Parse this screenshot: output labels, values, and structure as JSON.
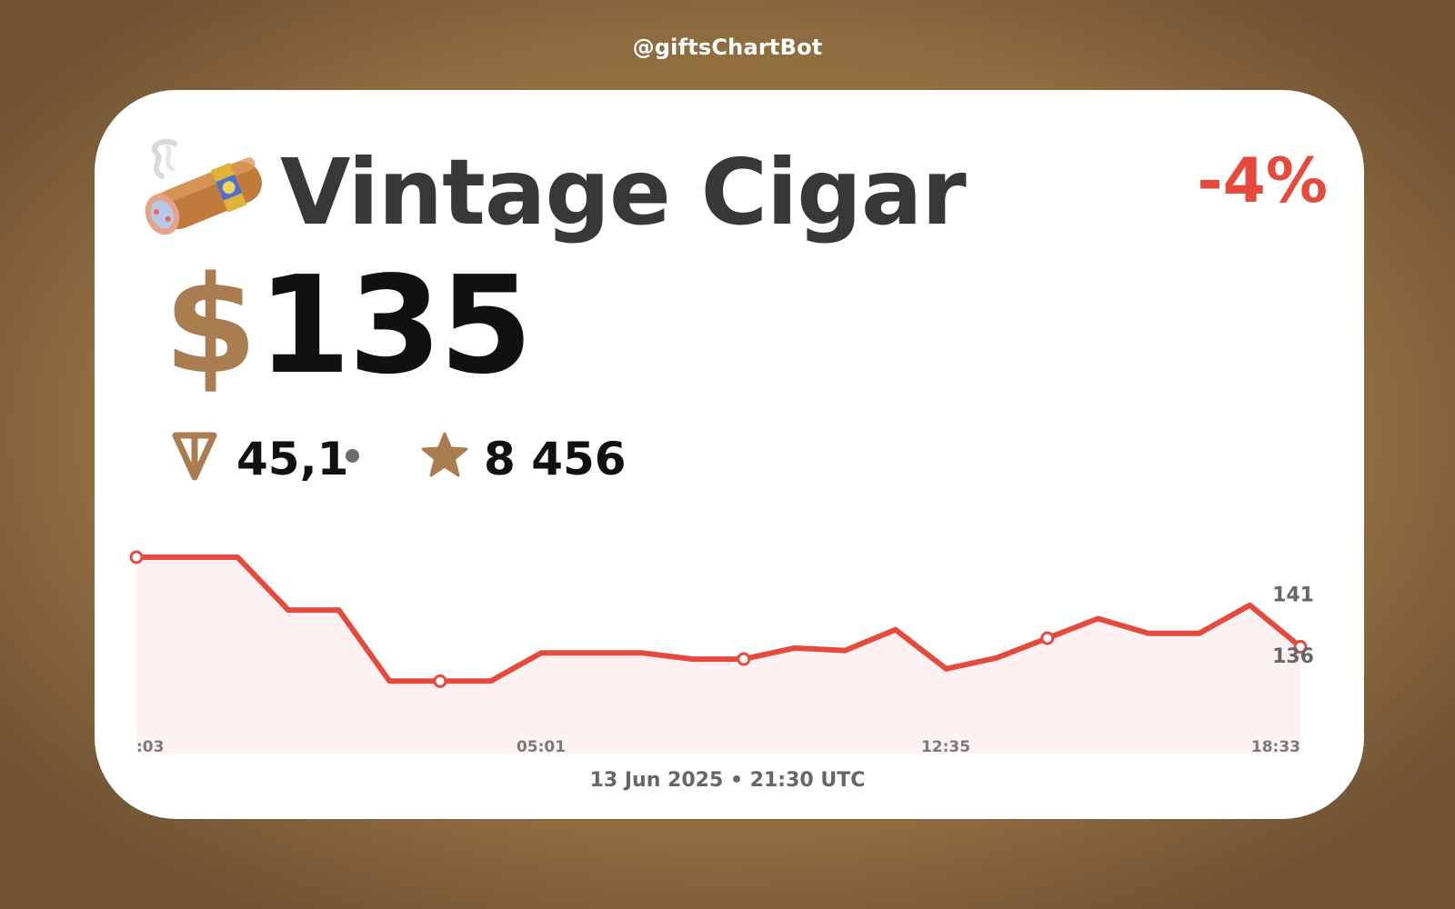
{
  "header": {
    "handle": "@giftsChartBot"
  },
  "gift": {
    "icon": "cigar-icon",
    "name": "Vintage Cigar",
    "change": "-4%",
    "price_currency": "$",
    "price_value": "135",
    "ton_icon": "ton-icon",
    "ton_value": "45,1",
    "star_icon": "star-icon",
    "stars_value": "8 456"
  },
  "footer": {
    "date": "13 Jun 2025",
    "time": "21:30 UTC"
  },
  "colors": {
    "brand": "#a97d4f",
    "negative": "#e54b3c",
    "text": "#383838"
  },
  "chart_data": {
    "type": "area",
    "x_tick_labels": [
      ":03",
      "05:01",
      "12:35",
      "18:33"
    ],
    "y_tick_labels": [
      "141",
      "136"
    ],
    "y_ticks": [
      141,
      136
    ],
    "ylim": [
      128,
      144
    ],
    "values": [
      144.0,
      144.0,
      144.0,
      139.7,
      139.7,
      133.9,
      133.9,
      133.9,
      136.2,
      136.2,
      136.2,
      135.7,
      135.7,
      136.6,
      136.4,
      138.1,
      134.9,
      135.8,
      137.4,
      139.0,
      137.8,
      137.8,
      140.1,
      136.7
    ],
    "markers": [
      0,
      6,
      12,
      18,
      23
    ],
    "grid": false,
    "legend": "none"
  }
}
